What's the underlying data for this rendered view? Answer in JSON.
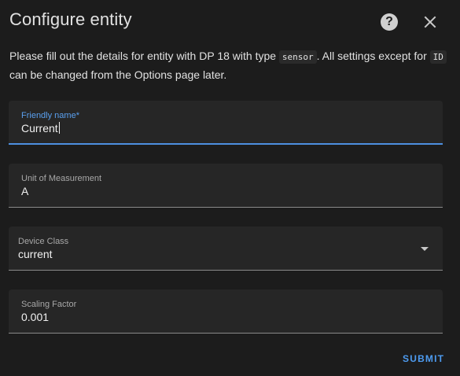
{
  "dialog": {
    "title": "Configure entity",
    "help_icon": "?",
    "close_icon": "close-icon"
  },
  "description": {
    "part1": "Please fill out the details for entity with DP 18 with type ",
    "code1": "sensor",
    "part2": ". All settings except for ",
    "code2": "ID",
    "part3": " can be changed from the Options page later."
  },
  "fields": {
    "friendly_name": {
      "label": "Friendly name*",
      "value": "Current"
    },
    "unit": {
      "label": "Unit of Measurement",
      "value": "A"
    },
    "device_class": {
      "label": "Device Class",
      "value": "current"
    },
    "scaling": {
      "label": "Scaling Factor",
      "value": "0.001"
    }
  },
  "actions": {
    "submit": "SUBMIT"
  },
  "colors": {
    "background": "#1c1c1c",
    "field": "#262626",
    "accent": "#4d9bf0"
  }
}
